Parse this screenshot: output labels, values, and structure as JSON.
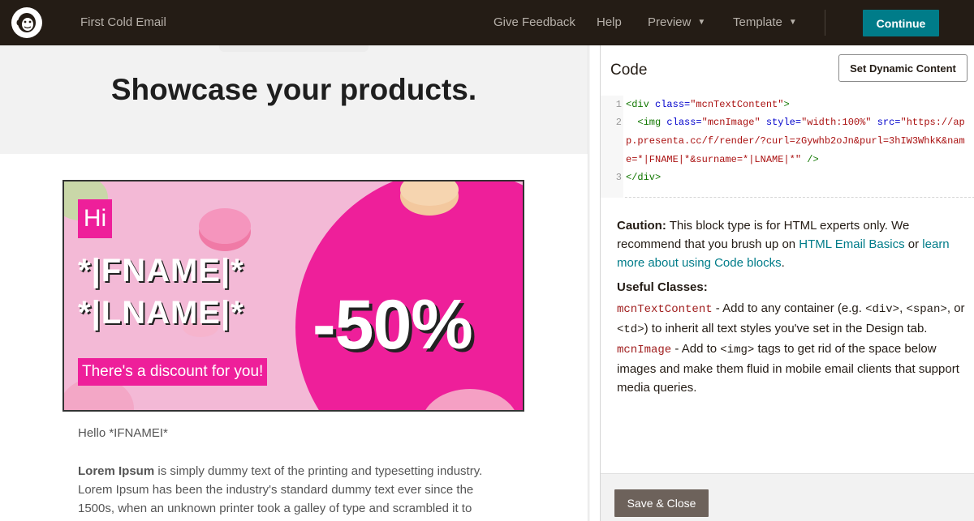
{
  "topbar": {
    "campaign_title": "First Cold Email",
    "nav": [
      {
        "label": "Give Feedback"
      },
      {
        "label": "Help"
      },
      {
        "label": "Preview"
      },
      {
        "label": "Template"
      }
    ],
    "continue_label": "Continue",
    "logo_icon": "mailchimp-freddie-icon",
    "accent_color": "#007c89"
  },
  "preview": {
    "hero_title": "Showcase your products.",
    "banner": {
      "hi": "Hi",
      "fname": "*|FNAME|*",
      "lname": "*|LNAME|*",
      "discount": "There's a discount for you!",
      "percent": "-50%",
      "pink_color": "#ee1f9a"
    },
    "greeting": "Hello *IFNAMEI*",
    "paragraph_bold": "Lorem Ipsum",
    "paragraph_rest": " is simply dummy text of the printing and typesetting industry. Lorem Ipsum has been the industry's standard dummy text ever since the 1500s, when an unknown printer took a galley of type and scrambled it to make"
  },
  "code_panel": {
    "heading": "Code",
    "dynamic_button": "Set Dynamic Content",
    "line_numbers": [
      "1",
      "2",
      "3"
    ],
    "code": {
      "l1_open": "<div ",
      "l1_attr": "class=",
      "l1_val": "\"mcnTextContent\"",
      "l1_close": ">",
      "l2_open": "  <img ",
      "l2_attr1": "class=",
      "l2_val1": "\"mcnImage\" ",
      "l2_attr2": "style=",
      "l2_val2": "\"width:100%\" ",
      "l2_attr3": "src=",
      "l2_val3a": "\"https://ap",
      "l2_val3b": "p.presenta.cc/f/render/?curl=zGywhb2oJn&purl=3hIW3WhkK&nam",
      "l2_val3c": "e=*|FNAME|*&surname=*|LNAME|*\"",
      "l2_close": " />",
      "l3": "</div>"
    },
    "caution_label": "Caution:",
    "caution_text": " This block type is for HTML experts only. We recommend that you brush up on ",
    "caution_link1": "HTML Email Basics",
    "caution_or": " or ",
    "caution_link2": "learn more about using Code blocks",
    "caution_end": ".",
    "useful_heading": "Useful Classes:",
    "class1_name": "mcnTextContent",
    "class1_desc_a": " - Add to any container (e.g. ",
    "class1_div": "<div>",
    "class1_comma": ", ",
    "class1_span": "<span>",
    "class1_or": ", or ",
    "class1_td": "<td>",
    "class1_desc_b": ") to inherit all text styles you've set in the Design tab.",
    "class2_name": "mcnImage",
    "class2_desc_a": " - Add to ",
    "class2_img": "<img>",
    "class2_desc_b": " tags to get rid of the space below images and make them fluid in mobile email clients that support media queries.",
    "save_label": "Save & Close"
  }
}
